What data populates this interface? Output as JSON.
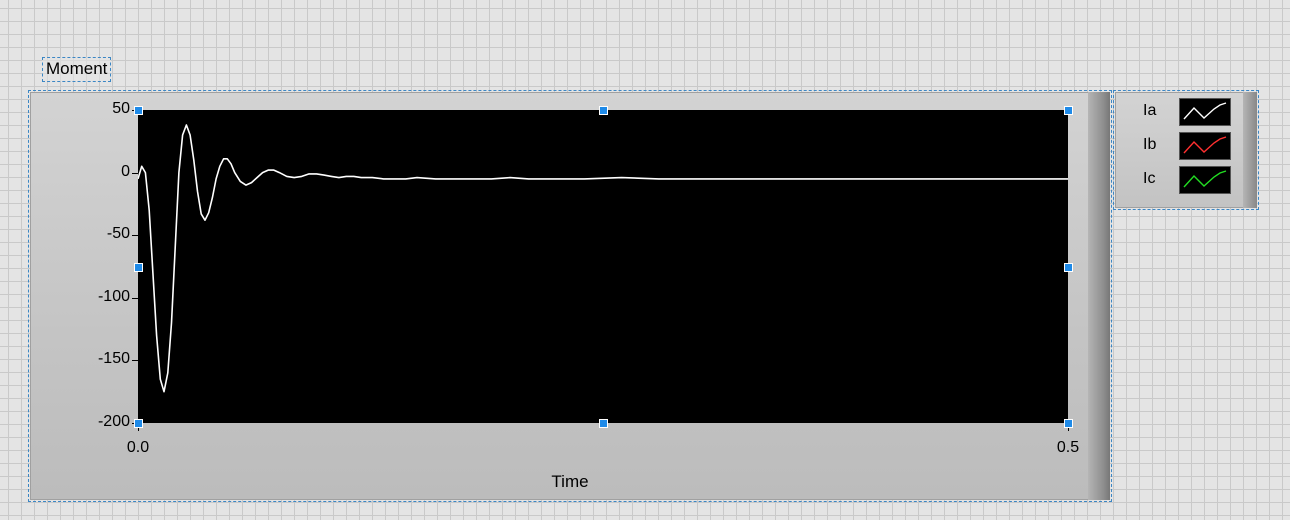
{
  "graph": {
    "label": "Moment",
    "legend": [
      {
        "name": "Ia",
        "color": "#ffffff"
      },
      {
        "name": "Ib",
        "color": "#ff3030"
      },
      {
        "name": "Ic",
        "color": "#22dd22"
      }
    ]
  },
  "chart_data": {
    "type": "line",
    "xlabel": "Time",
    "ylabel": "",
    "xlim": [
      0.0,
      0.5
    ],
    "ylim": [
      -200,
      50
    ],
    "x_ticks": [
      "0.0",
      "0.5"
    ],
    "y_ticks": [
      "50",
      "0",
      "-50",
      "-100",
      "-150",
      "-200"
    ],
    "background": "#000000",
    "grid": false,
    "legend_position": "right",
    "series": [
      {
        "name": "Ia",
        "color": "#ffffff",
        "x": [
          0.0,
          0.002,
          0.004,
          0.006,
          0.008,
          0.01,
          0.012,
          0.014,
          0.016,
          0.018,
          0.02,
          0.022,
          0.024,
          0.026,
          0.028,
          0.03,
          0.032,
          0.034,
          0.036,
          0.038,
          0.04,
          0.042,
          0.044,
          0.046,
          0.048,
          0.05,
          0.052,
          0.055,
          0.058,
          0.061,
          0.064,
          0.067,
          0.07,
          0.073,
          0.076,
          0.08,
          0.084,
          0.088,
          0.092,
          0.096,
          0.1,
          0.104,
          0.108,
          0.112,
          0.116,
          0.12,
          0.126,
          0.132,
          0.138,
          0.144,
          0.15,
          0.16,
          0.17,
          0.18,
          0.19,
          0.2,
          0.21,
          0.22,
          0.24,
          0.26,
          0.28,
          0.3,
          0.34,
          0.38,
          0.42,
          0.46,
          0.5
        ],
        "y": [
          -5,
          5,
          0,
          -30,
          -80,
          -130,
          -165,
          -175,
          -160,
          -120,
          -60,
          0,
          30,
          38,
          30,
          10,
          -15,
          -33,
          -38,
          -32,
          -20,
          -5,
          5,
          11,
          11,
          7,
          0,
          -7,
          -10,
          -8,
          -4,
          0,
          2,
          2,
          0,
          -3,
          -4,
          -3,
          -1,
          -1,
          -2,
          -3,
          -4,
          -3,
          -3,
          -4,
          -4,
          -5,
          -5,
          -5,
          -4,
          -5,
          -5,
          -5,
          -5,
          -4,
          -5,
          -5,
          -5,
          -4,
          -5,
          -5,
          -5,
          -5,
          -5,
          -5,
          -5
        ]
      }
    ]
  }
}
